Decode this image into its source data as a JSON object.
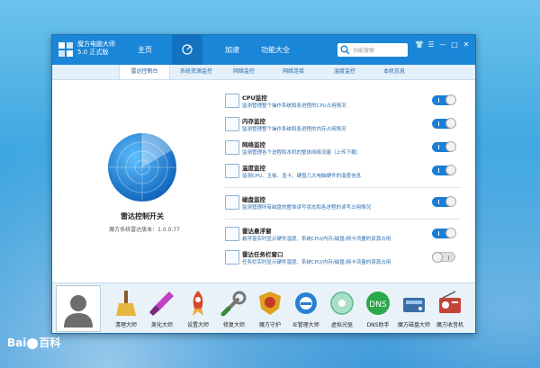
{
  "app": {
    "name": "魔方电脑大师",
    "version": "5.0 正式版"
  },
  "nav": {
    "home": "主页",
    "accelerate": "加速",
    "functions": "功能大全"
  },
  "search": {
    "placeholder": "功能搜索"
  },
  "tabs": [
    "雷达控制台",
    "系统资源监控",
    "网络监控",
    "网络连接",
    "温度监控",
    "本机信息"
  ],
  "radar": {
    "title": "雷达控制开关",
    "version": "魔方系统雷达版本：1.0.0.77"
  },
  "monitors": [
    {
      "title": "CPU监控",
      "desc": "监测管理整个操作系统和各进程的CPU占用情况",
      "on": true
    },
    {
      "title": "内存监控",
      "desc": "监测管理整个操作系统和各进程的内存占用情况",
      "on": true
    },
    {
      "title": "网络监控",
      "desc": "监测管理各个进程和本机的整体网络流量（上传下载）",
      "on": true
    },
    {
      "title": "温度监控",
      "desc": "监测CPU、主板、显卡、硬盘几大电脑硬件的温度信息",
      "on": true
    },
    {
      "title": "磁盘监控",
      "desc": "监测管理所有磁盘的整体读写状态和各进程的读写占用情况",
      "on": true
    },
    {
      "title": "雷达悬浮窗",
      "desc": "悬浮窗实时显示硬件温度、系统CPU/内存/磁盘/网卡流量的资源占用",
      "on": true
    },
    {
      "title": "雷达任务栏窗口",
      "desc": "任务栏实时显示硬件温度、系统CPU/内存/磁盘/网卡流量的资源占用",
      "on": false
    }
  ],
  "tools": [
    "清理大师",
    "美化大师",
    "设置大师",
    "修复大师",
    "魔方守护",
    "IE管理大师",
    "虚拟光驱",
    "DNS助手",
    "魔方磁盘大师",
    "魔方收音机"
  ],
  "watermark": {
    "brand1": "Bai",
    "brand2": "百科"
  },
  "colors": {
    "accent": "#1a86d8",
    "toggle_on": "#1a7fd4"
  }
}
